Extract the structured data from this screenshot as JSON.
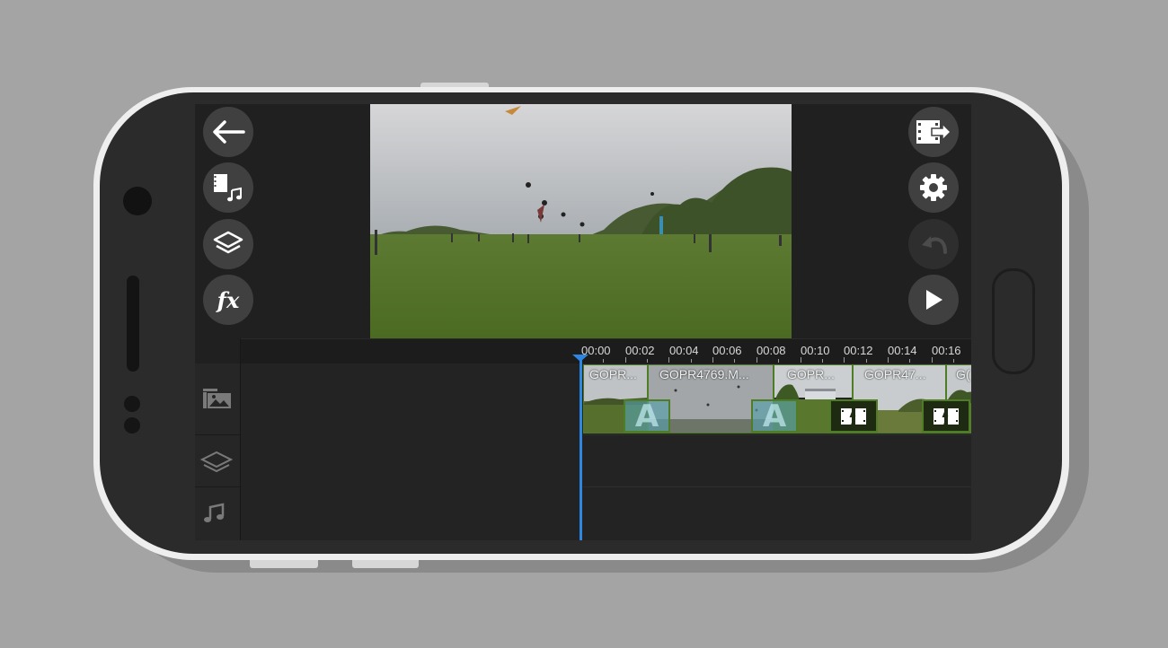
{
  "timeline": {
    "ruler_labels": [
      "00:00",
      "00:02",
      "00:04",
      "00:06",
      "00:08",
      "00:10",
      "00:12",
      "00:14",
      "00:16"
    ],
    "clips": [
      {
        "label": "GOPR..."
      },
      {
        "label": "GOPR4769.M..."
      },
      {
        "label": "GOPR..."
      },
      {
        "label": "GOPR47..."
      },
      {
        "label": "G("
      }
    ],
    "transitions": [
      "text-transition",
      "text-transition",
      "video-transition",
      "video-transition"
    ],
    "playhead_time": "00:00"
  },
  "left_toolbar": [
    "back-arrow-icon",
    "media-music-icon",
    "layers-icon",
    "fx-icon"
  ],
  "right_toolbar": [
    "export-video-icon",
    "settings-gear-icon",
    "undo-icon",
    "play-icon"
  ],
  "undo_enabled": false,
  "fx_label": "fx",
  "track_icons": [
    "video-image-track-icon",
    "layer-track-icon",
    "music-track-icon"
  ],
  "colors": {
    "accent": "#2f86e0",
    "clip_border": "#4f7d26",
    "screen_bg": "#202020"
  }
}
